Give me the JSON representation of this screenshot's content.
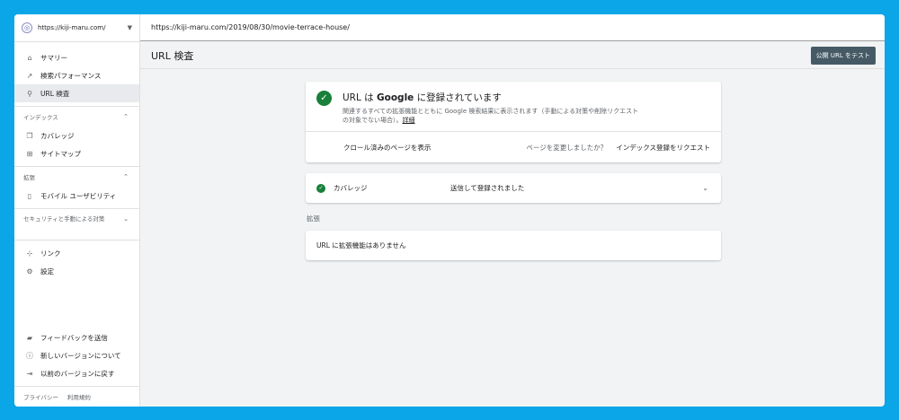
{
  "property": {
    "url": "https://kiji-maru.com/"
  },
  "nav": {
    "items": [
      {
        "label": "サマリー",
        "icon": "home-icon"
      },
      {
        "label": "検索パフォーマンス",
        "icon": "trend-icon"
      },
      {
        "label": "URL 検査",
        "icon": "search-icon",
        "active": true
      }
    ],
    "index_section": "インデックス",
    "index_items": [
      {
        "label": "カバレッジ",
        "icon": "coverage-icon"
      },
      {
        "label": "サイトマップ",
        "icon": "sitemap-icon"
      }
    ],
    "ext_section": "拡張",
    "ext_items": [
      {
        "label": "モバイル ユーザビリティ",
        "icon": "mobile-icon"
      }
    ],
    "security_section": "セキュリティと手動による対策",
    "other_items": [
      {
        "label": "リンク",
        "icon": "links-icon"
      },
      {
        "label": "設定",
        "icon": "settings-icon"
      }
    ],
    "footer_items": [
      {
        "label": "フィードバックを送信",
        "icon": "feedback-icon"
      },
      {
        "label": "新しいバージョンについて",
        "icon": "info-icon"
      },
      {
        "label": "以前のバージョンに戻す",
        "icon": "exit-icon"
      }
    ],
    "legal": {
      "privacy": "プライバシー",
      "terms": "利用規約"
    }
  },
  "urlbar": {
    "value": "https://kiji-maru.com/2019/08/30/movie-terrace-house/"
  },
  "header": {
    "title": "URL 検査",
    "test_button": "公開 URL をテスト"
  },
  "status": {
    "title_pre": "URL は ",
    "title_brand": "Google",
    "title_post": " に登録されています",
    "desc": "関連するすべての拡張機能とともに Google 検索結果に表示されます（手動による対策や削除リクエストの対象でない場合）。",
    "desc_link": "詳細",
    "crawled_link": "クロール済みのページを表示",
    "changed_question": "ページを変更しましたか？",
    "request_index": "インデックス登録をリクエスト"
  },
  "coverage": {
    "label": "カバレッジ",
    "value": "送信して登録されました"
  },
  "extensions": {
    "heading": "拡張",
    "empty": "URL に拡張機能はありません"
  },
  "colors": {
    "background": "#0aa6e8",
    "success": "#188038",
    "button": "#455a64"
  }
}
